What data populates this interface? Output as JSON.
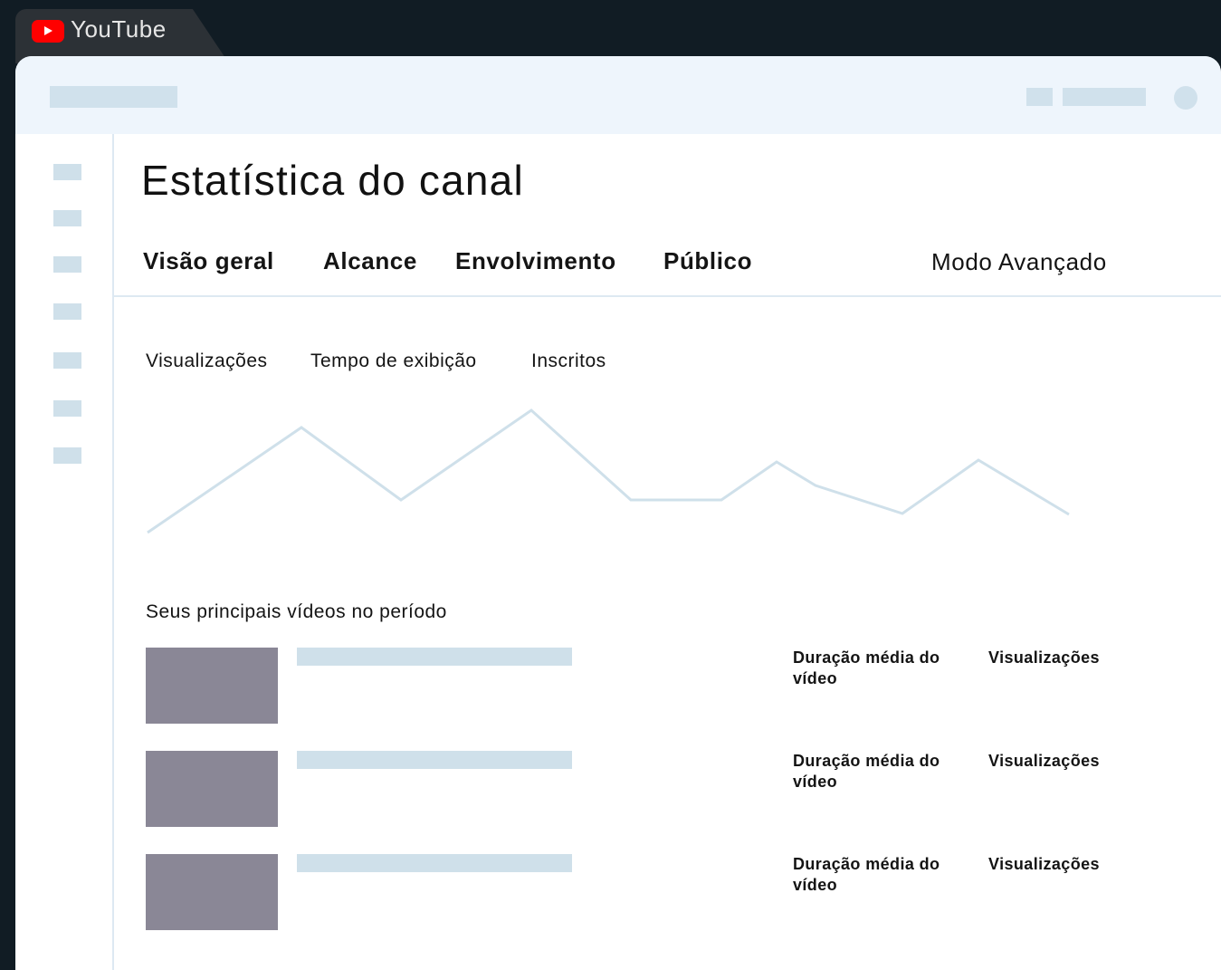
{
  "browser": {
    "tab_title": "YouTube",
    "brand_color": "#ff0000"
  },
  "header": {
    "page_title": "Estatística do canal"
  },
  "tabs": [
    {
      "label": "Visão geral"
    },
    {
      "label": "Alcance"
    },
    {
      "label": "Envolvimento"
    },
    {
      "label": "Público"
    }
  ],
  "advanced_mode_label": "Modo Avançado",
  "metrics": [
    {
      "label": "Visualizações"
    },
    {
      "label": "Tempo de exibição"
    },
    {
      "label": "Inscritos"
    }
  ],
  "top_videos": {
    "title": "Seus principais vídeos no período",
    "rows": [
      {
        "duration_label": "Duração média do vídeo",
        "views_label": "Visualizações"
      },
      {
        "duration_label": "Duração média do vídeo",
        "views_label": "Visualizações"
      },
      {
        "duration_label": "Duração média do vídeo",
        "views_label": "Visualizações"
      }
    ]
  },
  "colors": {
    "background": "#111c24",
    "topbar": "#eef5fc",
    "placeholder": "#cfe0ea",
    "thumbnail": "#8a8796",
    "chart_line": "#cfe0ea"
  }
}
